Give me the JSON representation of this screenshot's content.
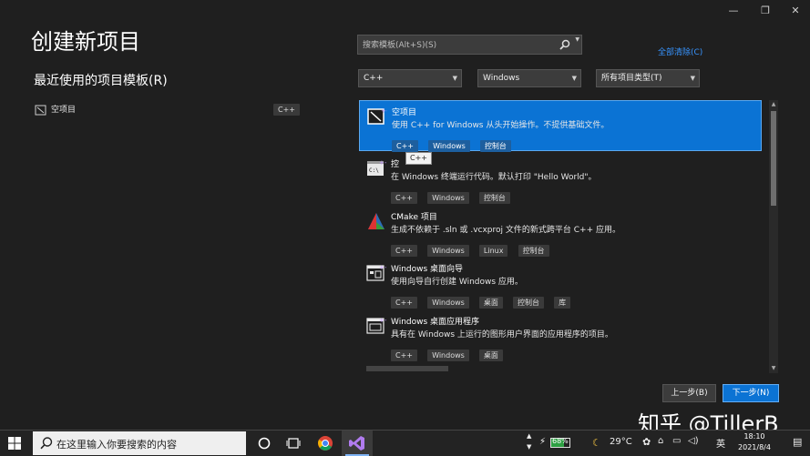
{
  "window": {
    "title": "创建新项目",
    "controls": {
      "minimize": "—",
      "restore": "❐",
      "close": "✕"
    }
  },
  "recent": {
    "heading": "最近使用的项目模板(R)",
    "items": [
      {
        "name": "空项目",
        "lang": "C++"
      }
    ]
  },
  "search": {
    "placeholder": "搜索模板(Alt+S)(S)",
    "clear_all": "全部清除(C)"
  },
  "filters": {
    "language": "C++",
    "platform": "Windows",
    "project_type": "所有项目类型(T)"
  },
  "templates": [
    {
      "name": "空项目",
      "desc": "使用 C++ for Windows 从头开始操作。不提供基础文件。",
      "tags": [
        "C++",
        "Windows",
        "控制台"
      ],
      "selected": true
    },
    {
      "name": "控制台应用",
      "name_visible": "控",
      "desc": "在 Windows 终端运行代码。默认打印 \"Hello World\"。",
      "tags": [
        "C++",
        "Windows",
        "控制台"
      ]
    },
    {
      "name": "CMake 项目",
      "desc": "生成不依赖于 .sln 或 .vcxproj 文件的新式跨平台 C++ 应用。",
      "tags": [
        "C++",
        "Windows",
        "Linux",
        "控制台"
      ]
    },
    {
      "name": "Windows 桌面向导",
      "desc": "使用向导自行创建 Windows 应用。",
      "tags": [
        "C++",
        "Windows",
        "桌面",
        "控制台",
        "库"
      ]
    },
    {
      "name": "Windows 桌面应用程序",
      "desc": "具有在 Windows 上运行的图形用户界面的应用程序的项目。",
      "tags": [
        "C++",
        "Windows",
        "桌面"
      ]
    }
  ],
  "tooltip": "C++",
  "buttons": {
    "back": "上一步(B)",
    "next": "下一步(N)"
  },
  "watermark": "知乎 @TillerB",
  "taskbar": {
    "search_placeholder": "在这里输入你要搜索的内容",
    "battery": "68%",
    "weather": "29°C",
    "ime": "英",
    "time": "18:10",
    "date": "2021/8/4"
  },
  "colors": {
    "accent": "#0b73d4",
    "background": "#1f1f1f",
    "link": "#3794ff"
  }
}
